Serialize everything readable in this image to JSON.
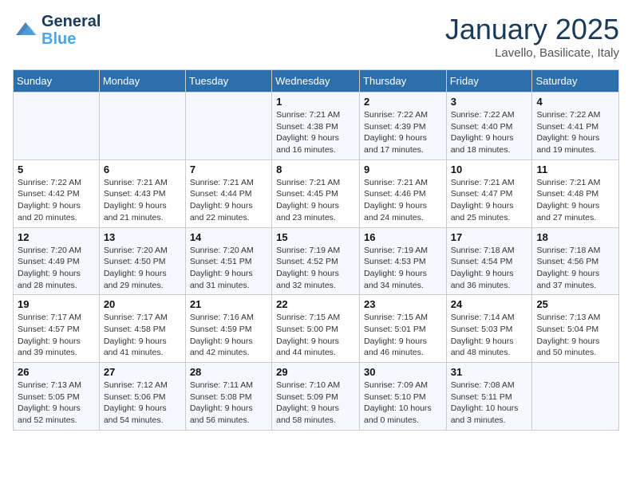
{
  "header": {
    "logo_line1": "General",
    "logo_line2": "Blue",
    "title": "January 2025",
    "subtitle": "Lavello, Basilicate, Italy"
  },
  "weekdays": [
    "Sunday",
    "Monday",
    "Tuesday",
    "Wednesday",
    "Thursday",
    "Friday",
    "Saturday"
  ],
  "rows": [
    [
      {
        "day": "",
        "info": ""
      },
      {
        "day": "",
        "info": ""
      },
      {
        "day": "",
        "info": ""
      },
      {
        "day": "1",
        "info": "Sunrise: 7:21 AM\nSunset: 4:38 PM\nDaylight: 9 hours and 16 minutes."
      },
      {
        "day": "2",
        "info": "Sunrise: 7:22 AM\nSunset: 4:39 PM\nDaylight: 9 hours and 17 minutes."
      },
      {
        "day": "3",
        "info": "Sunrise: 7:22 AM\nSunset: 4:40 PM\nDaylight: 9 hours and 18 minutes."
      },
      {
        "day": "4",
        "info": "Sunrise: 7:22 AM\nSunset: 4:41 PM\nDaylight: 9 hours and 19 minutes."
      }
    ],
    [
      {
        "day": "5",
        "info": "Sunrise: 7:22 AM\nSunset: 4:42 PM\nDaylight: 9 hours and 20 minutes."
      },
      {
        "day": "6",
        "info": "Sunrise: 7:21 AM\nSunset: 4:43 PM\nDaylight: 9 hours and 21 minutes."
      },
      {
        "day": "7",
        "info": "Sunrise: 7:21 AM\nSunset: 4:44 PM\nDaylight: 9 hours and 22 minutes."
      },
      {
        "day": "8",
        "info": "Sunrise: 7:21 AM\nSunset: 4:45 PM\nDaylight: 9 hours and 23 minutes."
      },
      {
        "day": "9",
        "info": "Sunrise: 7:21 AM\nSunset: 4:46 PM\nDaylight: 9 hours and 24 minutes."
      },
      {
        "day": "10",
        "info": "Sunrise: 7:21 AM\nSunset: 4:47 PM\nDaylight: 9 hours and 25 minutes."
      },
      {
        "day": "11",
        "info": "Sunrise: 7:21 AM\nSunset: 4:48 PM\nDaylight: 9 hours and 27 minutes."
      }
    ],
    [
      {
        "day": "12",
        "info": "Sunrise: 7:20 AM\nSunset: 4:49 PM\nDaylight: 9 hours and 28 minutes."
      },
      {
        "day": "13",
        "info": "Sunrise: 7:20 AM\nSunset: 4:50 PM\nDaylight: 9 hours and 29 minutes."
      },
      {
        "day": "14",
        "info": "Sunrise: 7:20 AM\nSunset: 4:51 PM\nDaylight: 9 hours and 31 minutes."
      },
      {
        "day": "15",
        "info": "Sunrise: 7:19 AM\nSunset: 4:52 PM\nDaylight: 9 hours and 32 minutes."
      },
      {
        "day": "16",
        "info": "Sunrise: 7:19 AM\nSunset: 4:53 PM\nDaylight: 9 hours and 34 minutes."
      },
      {
        "day": "17",
        "info": "Sunrise: 7:18 AM\nSunset: 4:54 PM\nDaylight: 9 hours and 36 minutes."
      },
      {
        "day": "18",
        "info": "Sunrise: 7:18 AM\nSunset: 4:56 PM\nDaylight: 9 hours and 37 minutes."
      }
    ],
    [
      {
        "day": "19",
        "info": "Sunrise: 7:17 AM\nSunset: 4:57 PM\nDaylight: 9 hours and 39 minutes."
      },
      {
        "day": "20",
        "info": "Sunrise: 7:17 AM\nSunset: 4:58 PM\nDaylight: 9 hours and 41 minutes."
      },
      {
        "day": "21",
        "info": "Sunrise: 7:16 AM\nSunset: 4:59 PM\nDaylight: 9 hours and 42 minutes."
      },
      {
        "day": "22",
        "info": "Sunrise: 7:15 AM\nSunset: 5:00 PM\nDaylight: 9 hours and 44 minutes."
      },
      {
        "day": "23",
        "info": "Sunrise: 7:15 AM\nSunset: 5:01 PM\nDaylight: 9 hours and 46 minutes."
      },
      {
        "day": "24",
        "info": "Sunrise: 7:14 AM\nSunset: 5:03 PM\nDaylight: 9 hours and 48 minutes."
      },
      {
        "day": "25",
        "info": "Sunrise: 7:13 AM\nSunset: 5:04 PM\nDaylight: 9 hours and 50 minutes."
      }
    ],
    [
      {
        "day": "26",
        "info": "Sunrise: 7:13 AM\nSunset: 5:05 PM\nDaylight: 9 hours and 52 minutes."
      },
      {
        "day": "27",
        "info": "Sunrise: 7:12 AM\nSunset: 5:06 PM\nDaylight: 9 hours and 54 minutes."
      },
      {
        "day": "28",
        "info": "Sunrise: 7:11 AM\nSunset: 5:08 PM\nDaylight: 9 hours and 56 minutes."
      },
      {
        "day": "29",
        "info": "Sunrise: 7:10 AM\nSunset: 5:09 PM\nDaylight: 9 hours and 58 minutes."
      },
      {
        "day": "30",
        "info": "Sunrise: 7:09 AM\nSunset: 5:10 PM\nDaylight: 10 hours and 0 minutes."
      },
      {
        "day": "31",
        "info": "Sunrise: 7:08 AM\nSunset: 5:11 PM\nDaylight: 10 hours and 3 minutes."
      },
      {
        "day": "",
        "info": ""
      }
    ]
  ]
}
